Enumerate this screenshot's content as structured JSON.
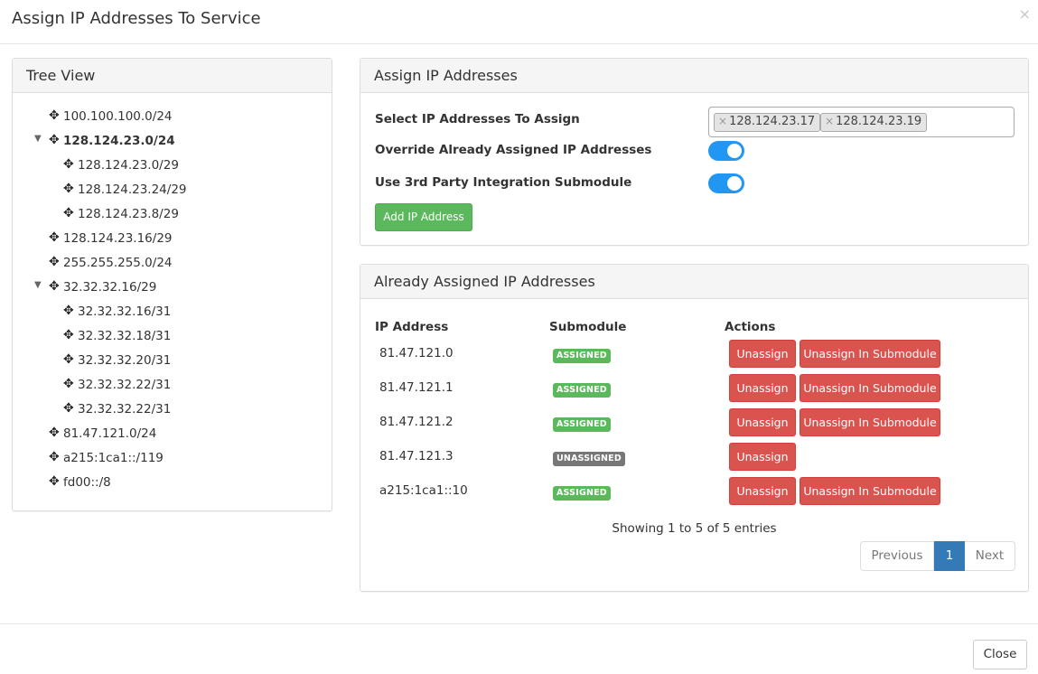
{
  "modal": {
    "title": "Assign IP Addresses To Service",
    "close_icon": "×",
    "footer_close_label": "Close"
  },
  "tree": {
    "heading": "Tree View",
    "nodes": [
      {
        "label": "100.100.100.0/24",
        "level": 0,
        "expanded": false,
        "bold": false
      },
      {
        "label": "128.124.23.0/24",
        "level": 0,
        "expanded": true,
        "bold": true
      },
      {
        "label": "128.124.23.0/29",
        "level": 1,
        "expanded": false,
        "bold": false
      },
      {
        "label": "128.124.23.24/29",
        "level": 1,
        "expanded": false,
        "bold": false
      },
      {
        "label": "128.124.23.8/29",
        "level": 1,
        "expanded": false,
        "bold": false
      },
      {
        "label": "128.124.23.16/29",
        "level": 0,
        "expanded": false,
        "bold": false
      },
      {
        "label": "255.255.255.0/24",
        "level": 0,
        "expanded": false,
        "bold": false
      },
      {
        "label": "32.32.32.16/29",
        "level": 0,
        "expanded": true,
        "bold": false
      },
      {
        "label": "32.32.32.16/31",
        "level": 1,
        "expanded": false,
        "bold": false
      },
      {
        "label": "32.32.32.18/31",
        "level": 1,
        "expanded": false,
        "bold": false
      },
      {
        "label": "32.32.32.20/31",
        "level": 1,
        "expanded": false,
        "bold": false
      },
      {
        "label": "32.32.32.22/31",
        "level": 1,
        "expanded": false,
        "bold": false
      },
      {
        "label": "32.32.32.22/31",
        "level": 1,
        "expanded": false,
        "bold": false
      },
      {
        "label": "81.47.121.0/24",
        "level": 0,
        "expanded": false,
        "bold": false
      },
      {
        "label": "a215:1ca1::/119",
        "level": 0,
        "expanded": false,
        "bold": false
      },
      {
        "label": "fd00::/8",
        "level": 0,
        "expanded": false,
        "bold": false
      }
    ]
  },
  "assign": {
    "heading": "Assign IP Addresses",
    "select_label": "Select IP Addresses To Assign",
    "selected_tags": [
      "128.124.23.17",
      "128.124.23.19"
    ],
    "override_label": "Override Already Assigned IP Addresses",
    "override_on": true,
    "third_party_label": "Use 3rd Party Integration Submodule",
    "third_party_on": true,
    "add_button_label": "Add IP Address"
  },
  "assigned": {
    "heading": "Already Assigned IP Addresses",
    "columns": [
      "IP Address",
      "Submodule",
      "Actions"
    ],
    "unassign_label": "Unassign",
    "unassign_sub_label": "Unassign In Submodule",
    "rows": [
      {
        "ip": "81.47.121.0",
        "status": "ASSIGNED",
        "assigned": true
      },
      {
        "ip": "81.47.121.1",
        "status": "ASSIGNED",
        "assigned": true
      },
      {
        "ip": "81.47.121.2",
        "status": "ASSIGNED",
        "assigned": true
      },
      {
        "ip": "81.47.121.3",
        "status": "UNASSIGNED",
        "assigned": false
      },
      {
        "ip": "a215:1ca1::10",
        "status": "ASSIGNED",
        "assigned": true
      }
    ],
    "showing_text": "Showing 1 to 5 of 5 entries",
    "pagination": {
      "previous": "Previous",
      "current": "1",
      "next": "Next"
    }
  },
  "colors": {
    "success": "#5cb85c",
    "danger": "#d9534f",
    "primary": "#337ab7",
    "toggle": "#2196f3",
    "badge_unassigned": "#777777"
  },
  "icons": {
    "tree_node": "move-icon",
    "expanded": "caret-down-icon",
    "tag_remove": "remove-tag-icon"
  }
}
